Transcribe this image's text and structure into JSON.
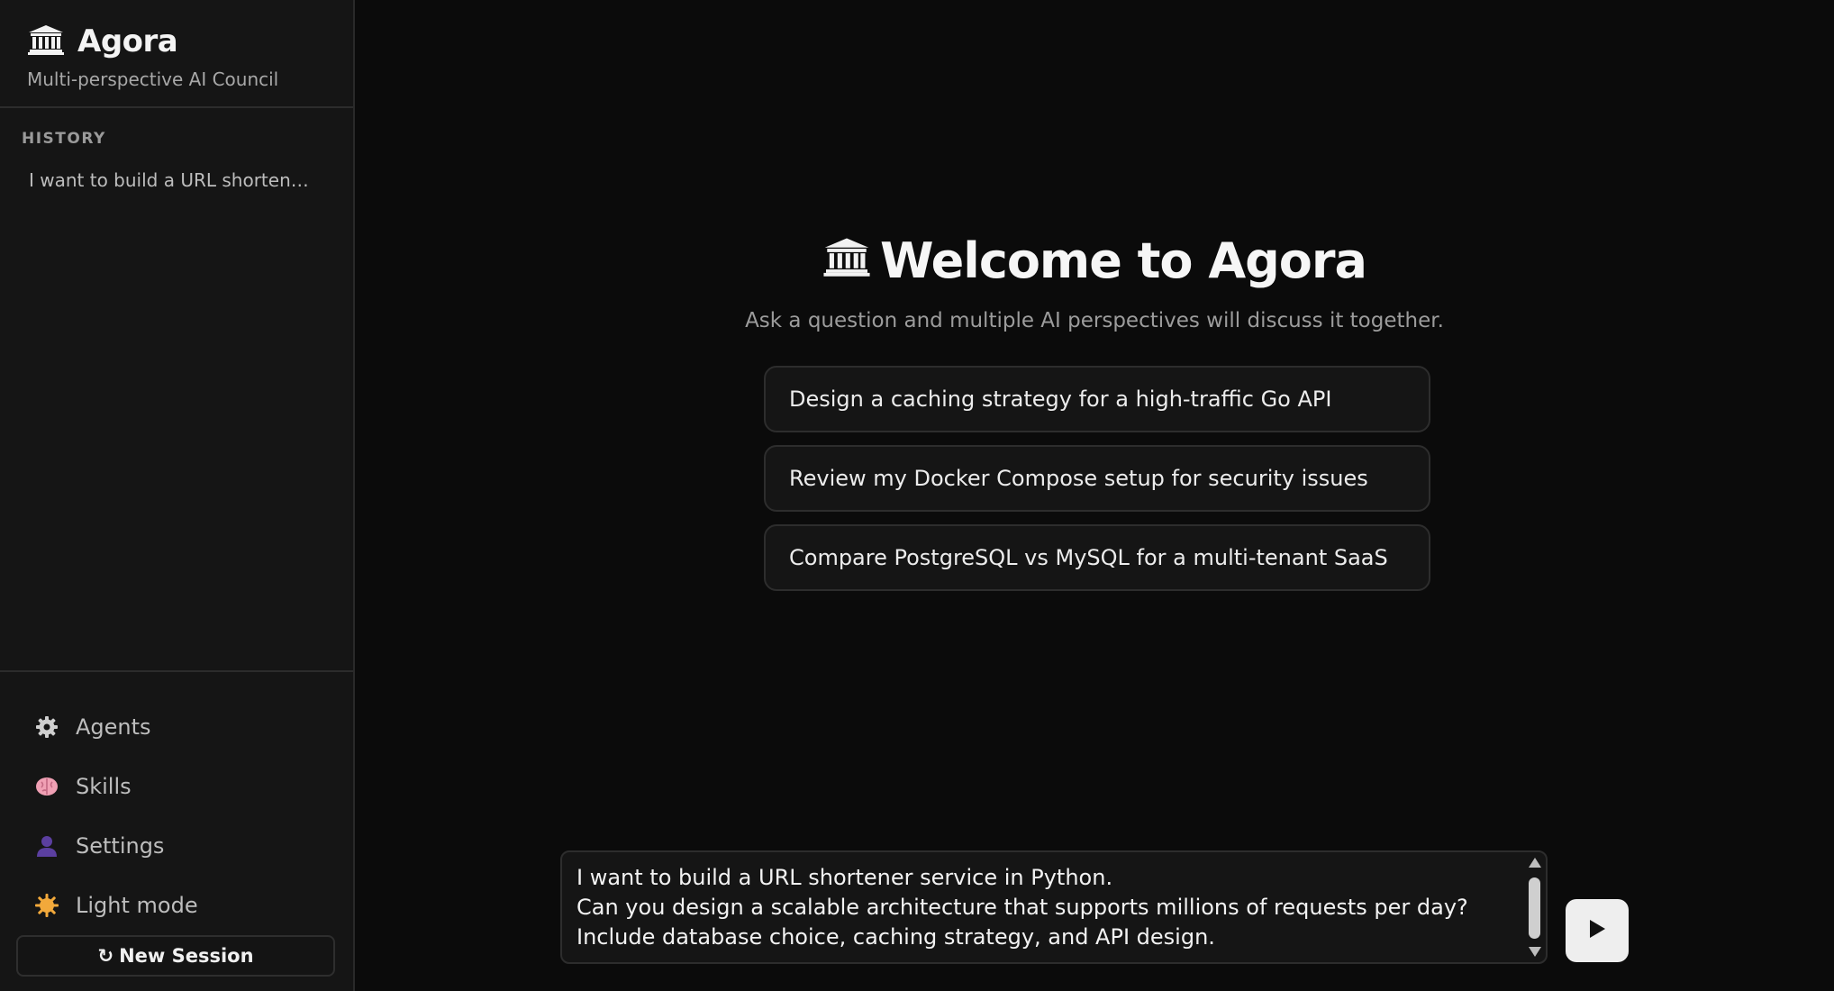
{
  "sidebar": {
    "brand": {
      "icon": "temple-icon",
      "title": "Agora",
      "subtitle": "Multi-perspective AI Council"
    },
    "history": {
      "header": "HISTORY",
      "items": [
        {
          "label": "I want to build a URL shortener service in Python."
        }
      ]
    },
    "nav": [
      {
        "icon": "gear-icon",
        "label": "Agents"
      },
      {
        "icon": "brain-icon",
        "label": "Skills"
      },
      {
        "icon": "user-icon",
        "label": "Settings"
      },
      {
        "icon": "sun-icon",
        "label": "Light mode"
      }
    ],
    "new_session": {
      "icon": "refresh-icon",
      "glyph": "↻",
      "label": "New Session"
    }
  },
  "main": {
    "welcome": {
      "icon": "temple-icon",
      "title": "Welcome to Agora",
      "subtitle": "Ask a question and multiple AI perspectives will discuss it together."
    },
    "suggestions": [
      "Design a caching strategy for a high-traffic Go API",
      "Review my Docker Compose setup for security issues",
      "Compare PostgreSQL vs MySQL for a multi-tenant SaaS"
    ],
    "composer": {
      "lines": [
        "I want to build a URL shortener service in Python.",
        "Can you design a scalable architecture that supports millions of requests per day?",
        "Include database choice, caching strategy, and API design."
      ]
    },
    "send_button": {
      "icon": "play-icon"
    }
  },
  "colors": {
    "background": "#0b0b0b",
    "sidebar": "#151515",
    "border": "#2d2d2d",
    "send_button": "#eeeeee",
    "sun": "#f2a93b",
    "brain": "#f0a0b4",
    "user": "#5b3fa0"
  }
}
